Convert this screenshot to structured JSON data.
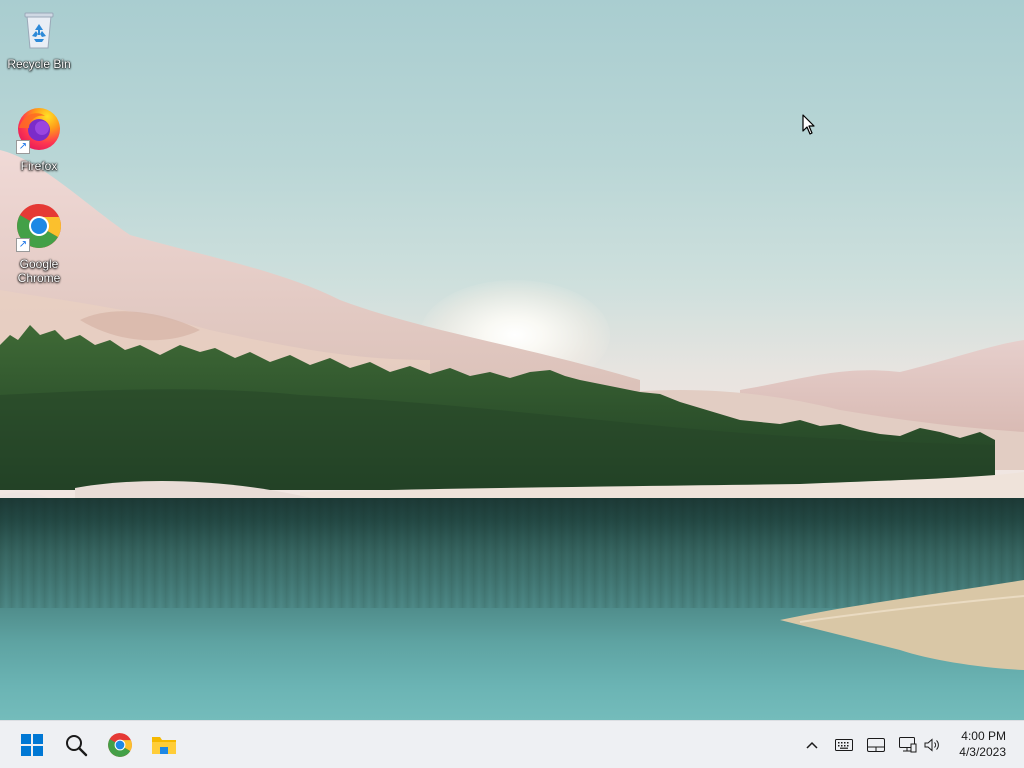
{
  "desktop": {
    "icons": [
      {
        "label": "Recycle Bin",
        "icon": "recycle-bin-icon"
      },
      {
        "label": "Firefox",
        "icon": "firefox-icon"
      },
      {
        "label": "Google Chrome",
        "icon": "chrome-icon"
      }
    ]
  },
  "taskbar": {
    "pinned": [
      {
        "name": "Start",
        "icon": "windows-start-icon"
      },
      {
        "name": "Search",
        "icon": "search-icon"
      },
      {
        "name": "Google Chrome",
        "icon": "chrome-icon"
      },
      {
        "name": "File Explorer",
        "icon": "folder-icon"
      }
    ],
    "tray": [
      {
        "name": "Show hidden icons",
        "icon": "chevron-up-icon"
      },
      {
        "name": "Keyboard",
        "icon": "keyboard-icon"
      },
      {
        "name": "Touchpad",
        "icon": "touchpad-icon"
      },
      {
        "name": "Network",
        "icon": "network-icon"
      },
      {
        "name": "Volume",
        "icon": "speaker-icon"
      }
    ],
    "clock": {
      "time": "4:00 PM",
      "date": "4/3/2023"
    }
  },
  "colors": {
    "accent": "#0078d4",
    "taskbar_bg": "#eef0f3"
  }
}
